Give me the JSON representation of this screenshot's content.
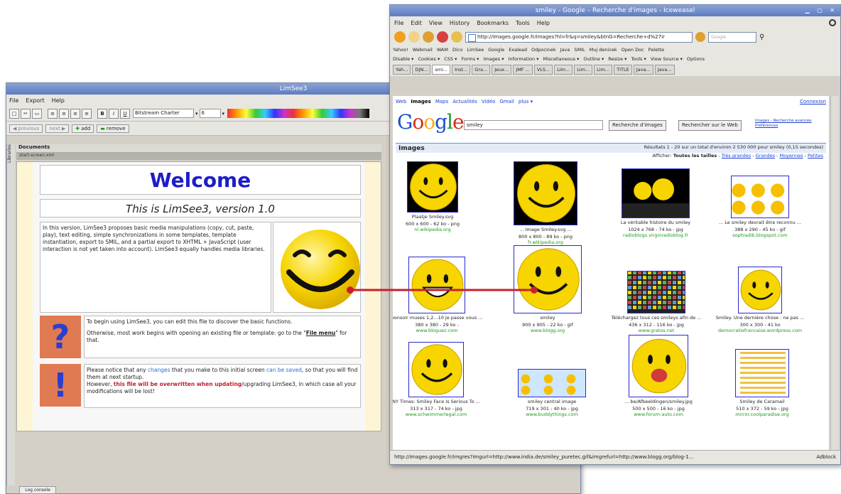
{
  "limsee": {
    "title": "LimSee3",
    "menu": [
      "File",
      "Export",
      "Help"
    ],
    "font_name": "Bitstream Charter",
    "font_size": "6",
    "nav": {
      "previous": "previous",
      "next": "next",
      "add": "add",
      "remove": "remove"
    },
    "documents_label": "Documents",
    "doc_tab": "start-screen.xml",
    "libraries_tab": "Libraries",
    "welcome": "Welcome",
    "version": "This is LimSee3, version 1.0",
    "intro": "In this version, LimSee3 proposes basic media manipulations (copy, cut, paste, play), text editing, simple synchronizations in some templates, template instantiation, export to SMIL, and a partial export to XHTML + JavaScript (user interaction is not yet taken into account). LimSee3 equally handles media libraries.",
    "tip1_a": "To begin using LimSee3, you can edit this file to discover the basic functions.",
    "tip1_b": "Otherwise, most work begins with opening an existing file or template: go to the \"",
    "tip1_file": "File menu",
    "tip1_c": "\" for that.",
    "tip2_a": "Please notice that any ",
    "tip2_changes": "changes",
    "tip2_b": " that you make to this initial screen ",
    "tip2_saved": "can be saved",
    "tip2_c": ", so that you will find them at next startup.",
    "tip2_d": "However, ",
    "tip2_overwritten": "this file will be overwritten when updating",
    "tip2_e": "/upgrading LimSee3, in which case all your modifications will be lost!",
    "log_console": "Log console",
    "icon_question": "?",
    "icon_exclaim": "!"
  },
  "ice": {
    "title": "smiley - Google – Recherche d'images - Iceweasel",
    "menu": [
      "File",
      "Edit",
      "View",
      "History",
      "Bookmarks",
      "Tools",
      "Help"
    ],
    "url": "http://images.google.fr/images?hl=fr&q=smiley&btnG=Recherche+d%27ir",
    "search_placeholder": "Google",
    "bookmarks1": [
      "Yahoo!",
      "Webmail",
      "WAM",
      "Dico",
      "LimSee",
      "Google",
      "Exalead",
      "Odpocinek",
      "Java",
      "SMIL",
      "Muj denicek",
      "Open Doc",
      "Palette"
    ],
    "bookmarks2": [
      "Disable ▾",
      "Cookies ▾",
      "CSS ▾",
      "Forms ▾",
      "Images ▾",
      "Information ▾",
      "Miscellaneous ▾",
      "Outline ▾",
      "Resize ▾",
      "Tools ▾",
      "View Source ▾",
      "Options"
    ],
    "tabs": [
      "Yah...",
      "DJN...",
      "smi...",
      "Inst...",
      "Gra...",
      "Jeux...",
      "JMF ...",
      "VLS...",
      "Lim...",
      "Lim...",
      "Lim...",
      "TITLE",
      "Java...",
      "Java..."
    ],
    "status": "http://images.google.fr/imgres?imgurl=http://www.india.de/smiley_puretec.gif&imgrefurl=http://www.blogg.org/blog-1...",
    "adblock": "Adblock"
  },
  "google": {
    "nav": [
      "Web",
      "Images",
      "Maps",
      "Actualités",
      "Vidéo",
      "Gmail",
      "plus ▾"
    ],
    "connexion": "Connexion",
    "logo_letters": [
      "G",
      "o",
      "o",
      "g",
      "l",
      "e"
    ],
    "logo_colors": [
      "#1a4fd1",
      "#d62b1f",
      "#f0b21a",
      "#1a4fd1",
      "#1a9a2a",
      "#d62b1f"
    ],
    "query": "smiley",
    "btn_images": "Recherche d'images",
    "btn_web": "Rechercher sur le Web",
    "advanced": "Images - Recherche avancée",
    "preferences": "Préférences",
    "images_label": "Images",
    "results": "Résultats 1 - 20 sur un total d'environ 2 530 000 pour smiley (0,15 secondes)",
    "show_label": "Afficher:",
    "show_all": "Toutes les tailles",
    "show_options": [
      "Très grandes",
      "Grandes",
      "Moyennes",
      "Petites"
    ],
    "thumbs": [
      {
        "cap": "Plaatje Smiley.svg",
        "dim": "600 x 600 - 62 ko - png",
        "site": "nl.wikipedia.org"
      },
      {
        "cap": "... Image Smiley.svg ...",
        "dim": "800 x 800 - 89 ko - png",
        "site": "fr.wikipedia.org"
      },
      {
        "cap": "La véritable histoire du smiley",
        "dim": "1024 x 768 - 74 ko - jpg",
        "site": "radioblogs.virginradioblog.fr"
      },
      {
        "cap": "... Le smiley devrait être reconnu ...",
        "dim": "388 x 290 - 45 ko - gif",
        "site": "sophiadib.blogspot.com"
      },
      {
        "cap": "bonsoir muses 1,2...10 je passe vous ...",
        "dim": "380 x 380 - 29 ko -",
        "site": "www.bloguez.com"
      },
      {
        "cap": "smiley",
        "dim": "900 x 905 - 22 ko - gif",
        "site": "www.blogg.org"
      },
      {
        "cap": "Téléchargez tous ces smileys afin de ...",
        "dim": "436 x 312 - 116 ko - jpg",
        "site": "www.gratos.net"
      },
      {
        "cap": "Smiley. Une dernière chose : ne pas ...",
        "dim": "300 x 300 - 41 ko",
        "site": "democratiefrancaise.wordpress.com"
      },
      {
        "cap": "NY Times: Smiley Face Is Serious To ...",
        "dim": "313 x 317 - 74 ko - jpg",
        "site": "www.schwimmerlegal.com"
      },
      {
        "cap": "smiley central image",
        "dim": "719 x 301 - 40 ko - jpg",
        "site": "www.buddythings.com"
      },
      {
        "cap": "... be/Afbeeldingen/smiley.jpg",
        "dim": "500 x 500 - 16 ko - jpg",
        "site": "www.forum-auto.com"
      },
      {
        "cap": "Smiley de Caramail",
        "dim": "510 x 372 - 59 ko - jpg",
        "site": "mirror.coolparadise.org"
      }
    ]
  },
  "colors": {
    "accent_red": "#c8202a",
    "title_blue": "#1d1dc7",
    "link_blue": "#1a3fcf",
    "site_green": "#1a9a1a",
    "smiley_yellow": "#f6d500"
  }
}
